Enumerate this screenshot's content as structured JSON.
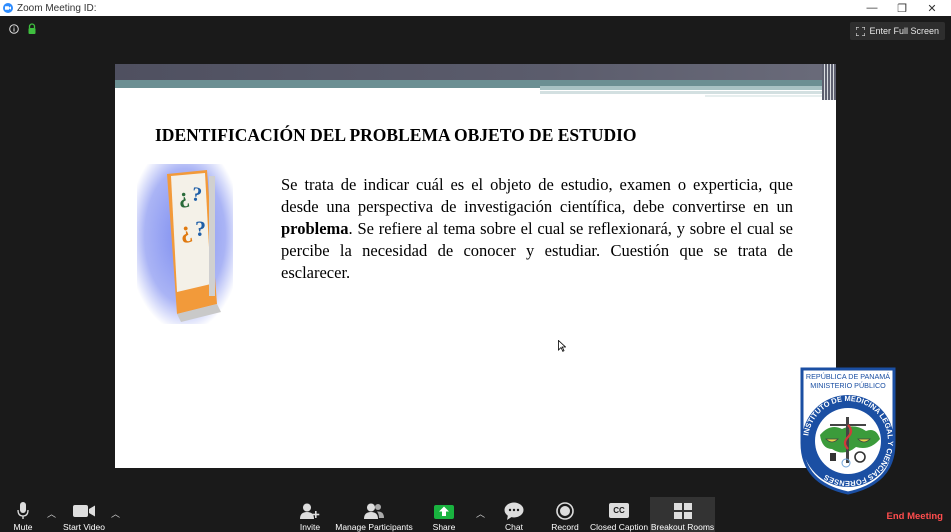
{
  "window": {
    "title": "Zoom Meeting ID:",
    "minimize": "—",
    "restore": "❐",
    "close": "✕"
  },
  "topbar": {
    "fullscreen_label": "Enter Full Screen"
  },
  "slide": {
    "title": "IDENTIFICACIÓN DEL PROBLEMA OBJETO DE ESTUDIO",
    "body_part1": "Se trata de indicar cuál es el objeto de estudio, examen o experticia, que desde una perspectiva de investigación científica, debe convertirse en un ",
    "body_bold": "problema",
    "body_part2": ". Se refiere al tema sobre el cual se reflexionará, y sobre el cual se percibe la necesidad de conocer y estudiar.  Cuestión que se trata de esclarecer."
  },
  "seal": {
    "line1": "REPÚBLICA DE PANAMÁ",
    "line2": "MINISTERIO PÚBLICO",
    "ring_text": "INSTITUTO DE MEDICINA LEGAL Y CIENCIAS FORENSES"
  },
  "toolbar": {
    "mute": "Mute",
    "start_video": "Start Video",
    "invite": "Invite",
    "manage_participants": "Manage Participants",
    "share": "Share",
    "chat": "Chat",
    "record": "Record",
    "closed_caption": "Closed Caption",
    "breakout_rooms": "Breakout Rooms",
    "end_meeting": "End Meeting",
    "cc_icon_text": "CC"
  },
  "colors": {
    "zoom_blue": "#2d8cff",
    "share_green": "#19b33f",
    "end_red": "#ff4d4d"
  }
}
